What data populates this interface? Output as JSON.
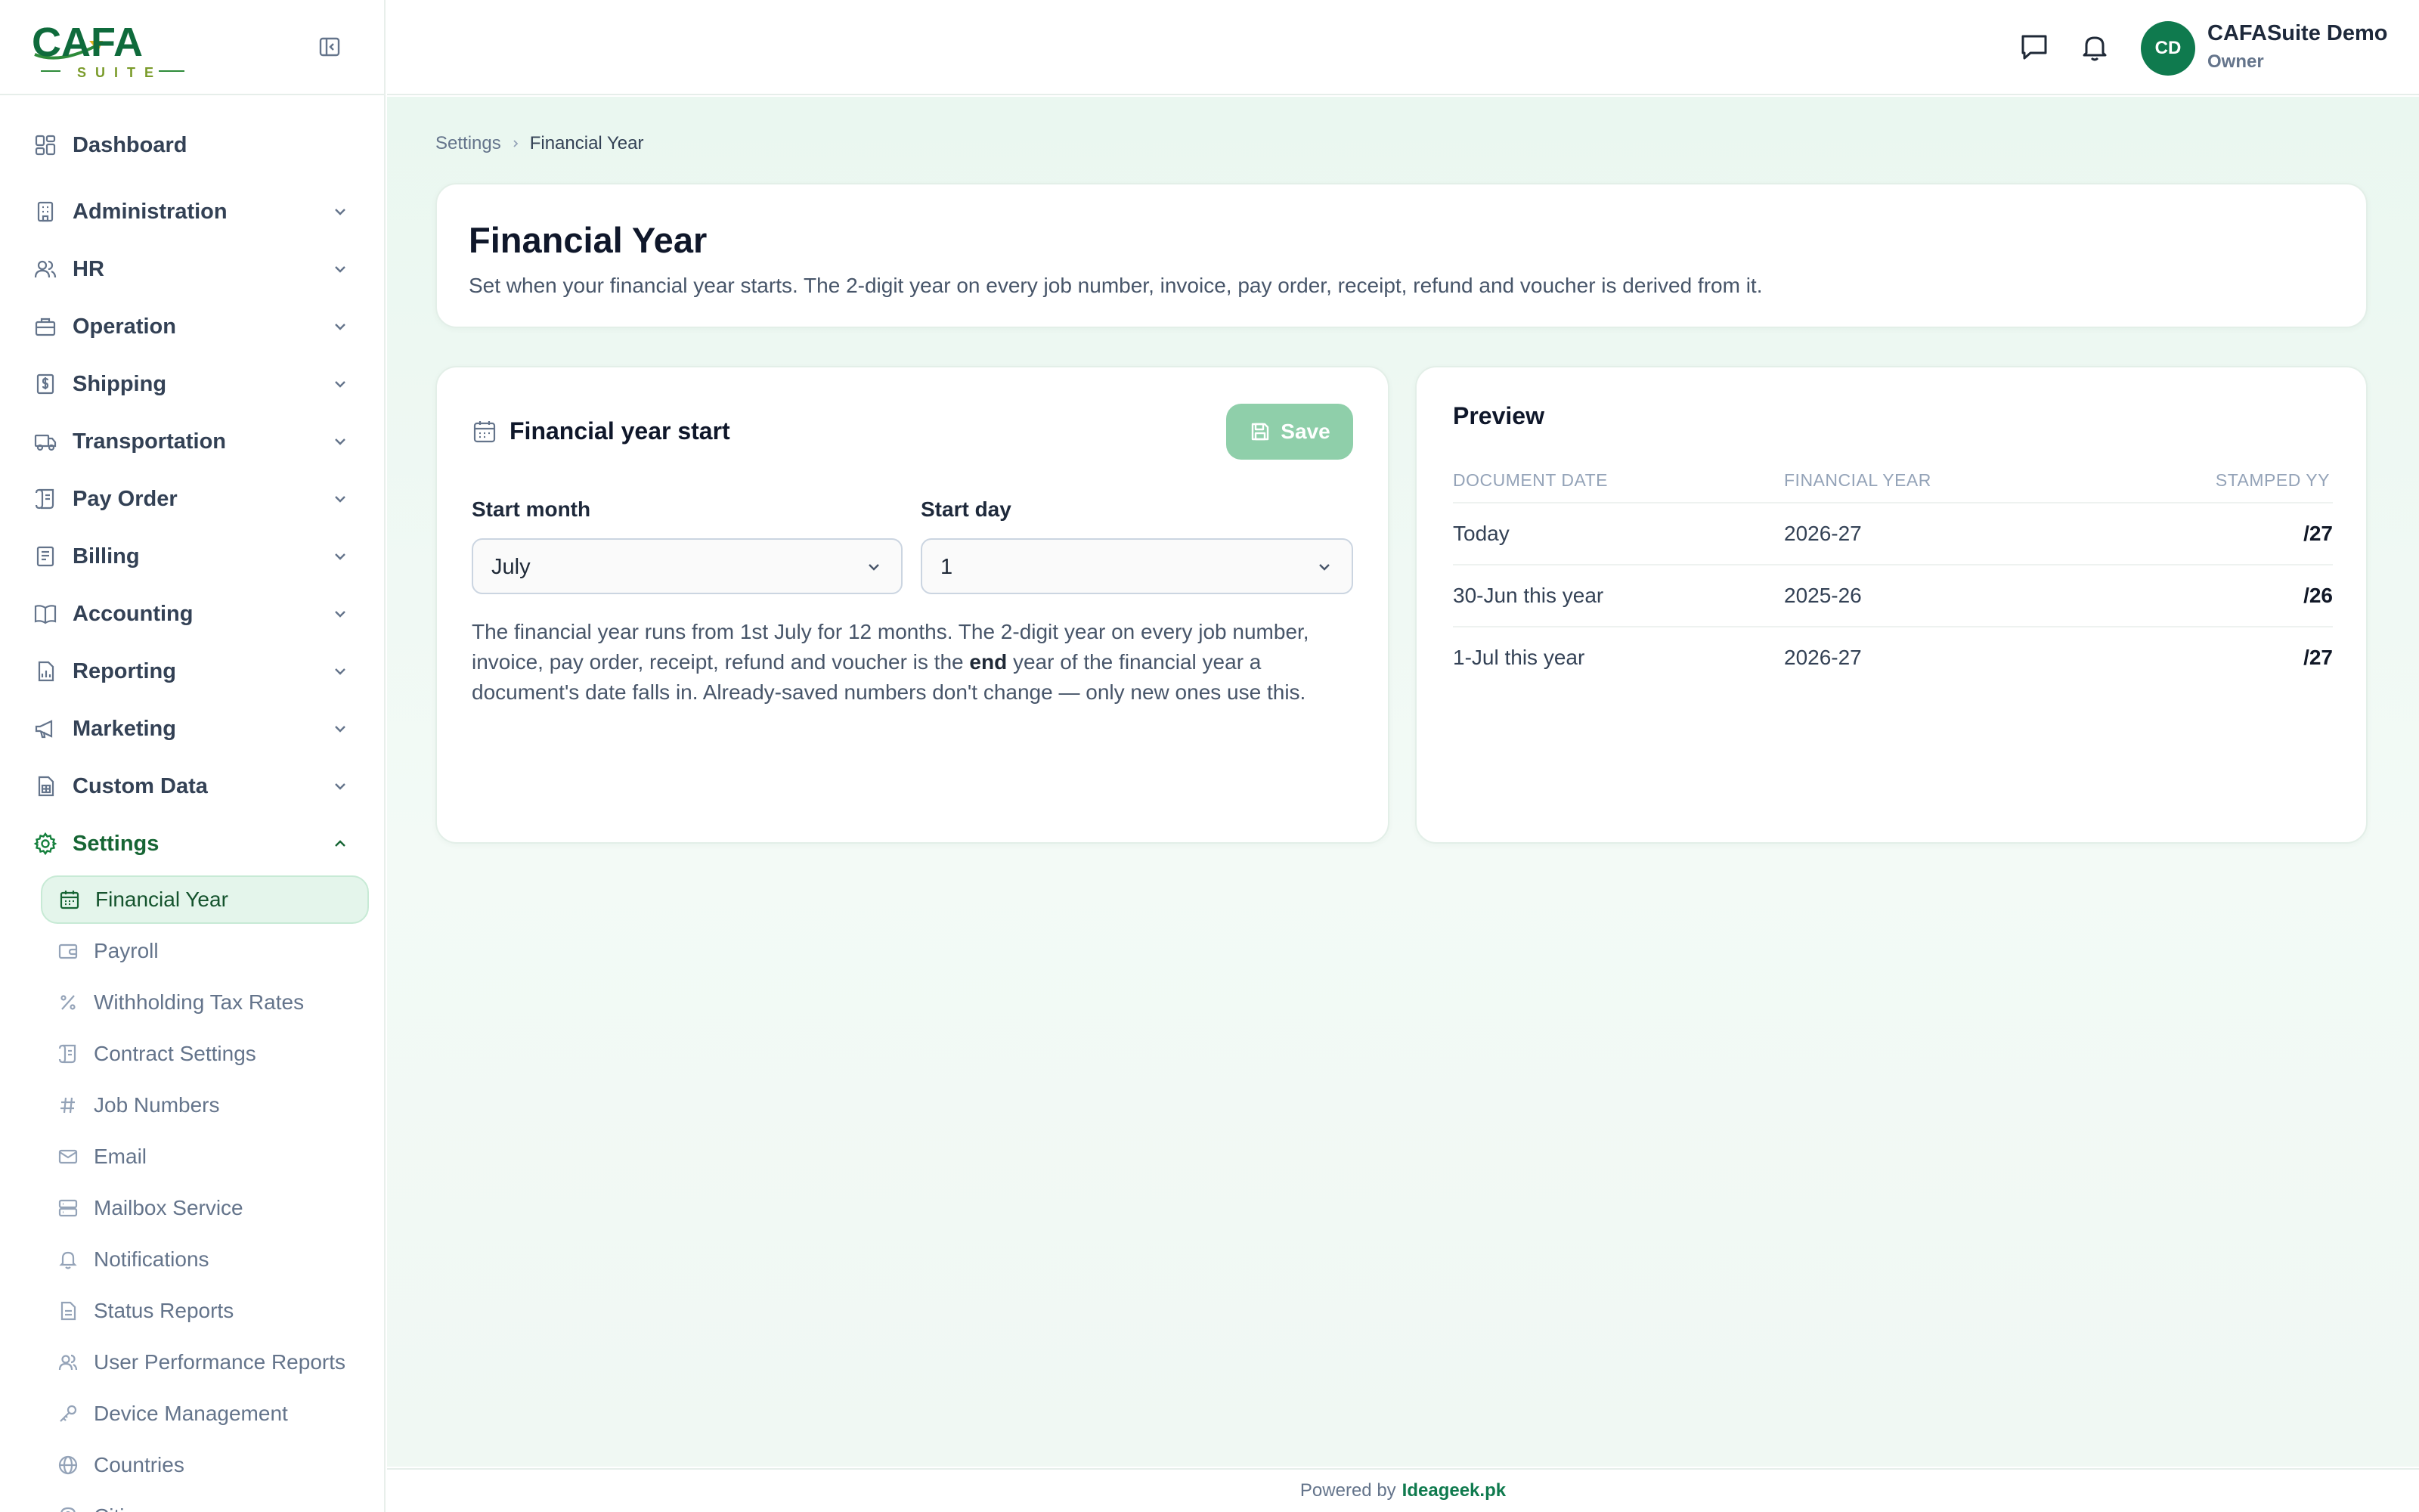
{
  "brand": {
    "logo_text": "CAFA",
    "logo_sub": "SUITE",
    "accent": "#0f7a4e"
  },
  "sidebar": {
    "items": [
      {
        "label": "Dashboard",
        "icon": "dashboard-icon",
        "expandable": false
      },
      {
        "label": "Administration",
        "icon": "building-icon",
        "expandable": true
      },
      {
        "label": "HR",
        "icon": "users-icon",
        "expandable": true
      },
      {
        "label": "Operation",
        "icon": "briefcase-icon",
        "expandable": true
      },
      {
        "label": "Shipping",
        "icon": "dollar-file-icon",
        "expandable": true
      },
      {
        "label": "Transportation",
        "icon": "truck-icon",
        "expandable": true
      },
      {
        "label": "Pay Order",
        "icon": "receipt-icon",
        "expandable": true
      },
      {
        "label": "Billing",
        "icon": "invoice-icon",
        "expandable": true
      },
      {
        "label": "Accounting",
        "icon": "book-icon",
        "expandable": true
      },
      {
        "label": "Reporting",
        "icon": "chart-file-icon",
        "expandable": true
      },
      {
        "label": "Marketing",
        "icon": "megaphone-icon",
        "expandable": true
      },
      {
        "label": "Custom Data",
        "icon": "table-file-icon",
        "expandable": true
      },
      {
        "label": "Settings",
        "icon": "gear-icon",
        "expandable": true,
        "expanded": true
      }
    ],
    "settings_items": [
      {
        "label": "Financial Year",
        "icon": "calendar-icon",
        "active": true
      },
      {
        "label": "Payroll",
        "icon": "wallet-icon"
      },
      {
        "label": "Withholding Tax Rates",
        "icon": "percent-icon"
      },
      {
        "label": "Contract Settings",
        "icon": "scroll-icon"
      },
      {
        "label": "Job Numbers",
        "icon": "hash-icon"
      },
      {
        "label": "Email",
        "icon": "mail-icon"
      },
      {
        "label": "Mailbox Service",
        "icon": "server-icon"
      },
      {
        "label": "Notifications",
        "icon": "bell-icon"
      },
      {
        "label": "Status Reports",
        "icon": "file-icon"
      },
      {
        "label": "User Performance Reports",
        "icon": "users-icon"
      },
      {
        "label": "Device Management",
        "icon": "key-icon"
      },
      {
        "label": "Countries",
        "icon": "globe-icon"
      },
      {
        "label": "Cities",
        "icon": "pin-icon"
      }
    ]
  },
  "header": {
    "user_name": "CAFASuite Demo",
    "user_role": "Owner",
    "avatar_initials": "CD"
  },
  "breadcrumb": {
    "parent": "Settings",
    "current": "Financial Year"
  },
  "page": {
    "title": "Financial Year",
    "description": "Set when your financial year starts. The 2-digit year on every job number, invoice, pay order, receipt, refund and voucher is derived from it."
  },
  "fy_card": {
    "title": "Financial year start",
    "save_label": "Save",
    "start_month_label": "Start month",
    "start_month_value": "July",
    "start_day_label": "Start day",
    "start_day_value": "1",
    "help_before": "The financial year runs from 1st July for 12 months. The 2-digit year on every job number, invoice, pay order, receipt, refund and voucher is the ",
    "help_bold": "end",
    "help_after": " year of the financial year a document's date falls in. Already-saved numbers don't change — only new ones use this."
  },
  "preview": {
    "title": "Preview",
    "columns": [
      "DOCUMENT DATE",
      "FINANCIAL YEAR",
      "STAMPED YY"
    ],
    "rows": [
      [
        "Today",
        "2026-27",
        "/27"
      ],
      [
        "30-Jun this year",
        "2025-26",
        "/26"
      ],
      [
        "1-Jul this year",
        "2026-27",
        "/27"
      ]
    ]
  },
  "footer": {
    "prefix": "Powered by",
    "link": "Ideageek.pk"
  }
}
